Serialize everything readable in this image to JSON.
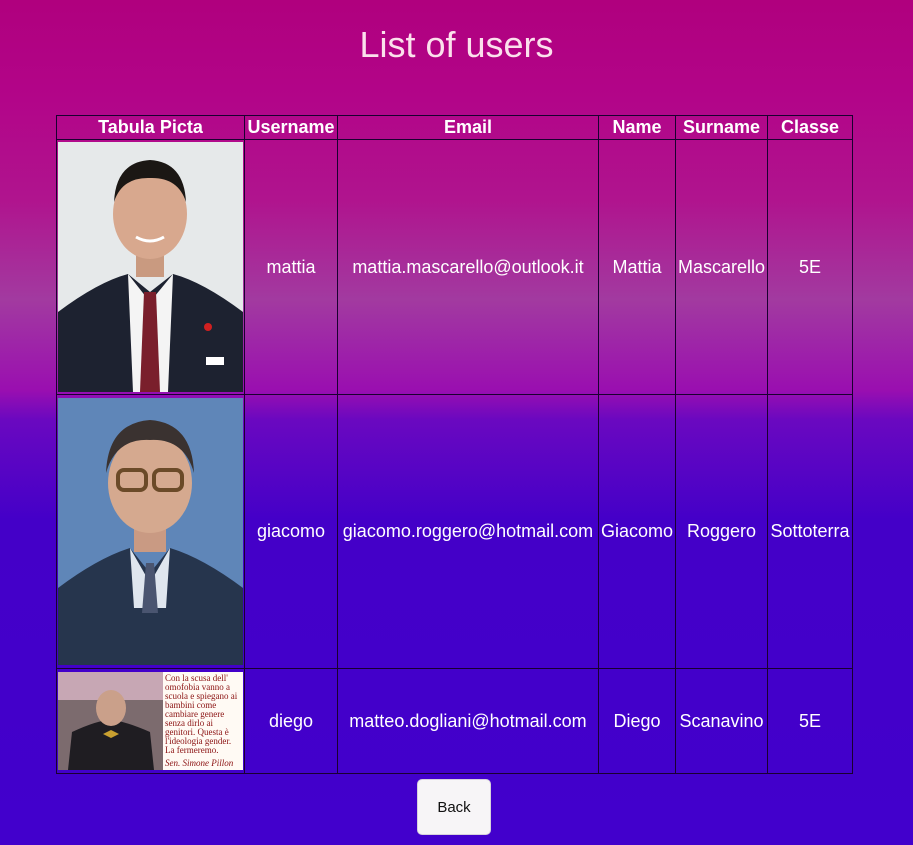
{
  "page": {
    "title": "List of users"
  },
  "table": {
    "headers": [
      "Tabula Picta",
      "Username",
      "Email",
      "Name",
      "Surname",
      "Classe"
    ],
    "rows": [
      {
        "username": "mattia",
        "email": "mattia.mascarello@outlook.it",
        "name": "Mattia",
        "surname": "Mascarello",
        "classe": "5E"
      },
      {
        "username": "giacomo",
        "email": "giacomo.roggero@hotmail.com",
        "name": "Giacomo",
        "surname": "Roggero",
        "classe": "Sottoterra"
      },
      {
        "username": "diego",
        "email": "matteo.dogliani@hotmail.com",
        "name": "Diego",
        "surname": "Scanavino",
        "classe": "5E"
      }
    ]
  },
  "photo3_caption": [
    "Con la scusa dell'",
    "omofobia vanno a",
    "scuola e spiegano ai",
    "bambini come",
    "cambiare genere",
    "senza dirlo ai",
    "genitori. Questa è",
    "l'ideologia gender.",
    "La fermeremo.",
    "Sen. Simone Pillon"
  ],
  "back_label": "Back"
}
